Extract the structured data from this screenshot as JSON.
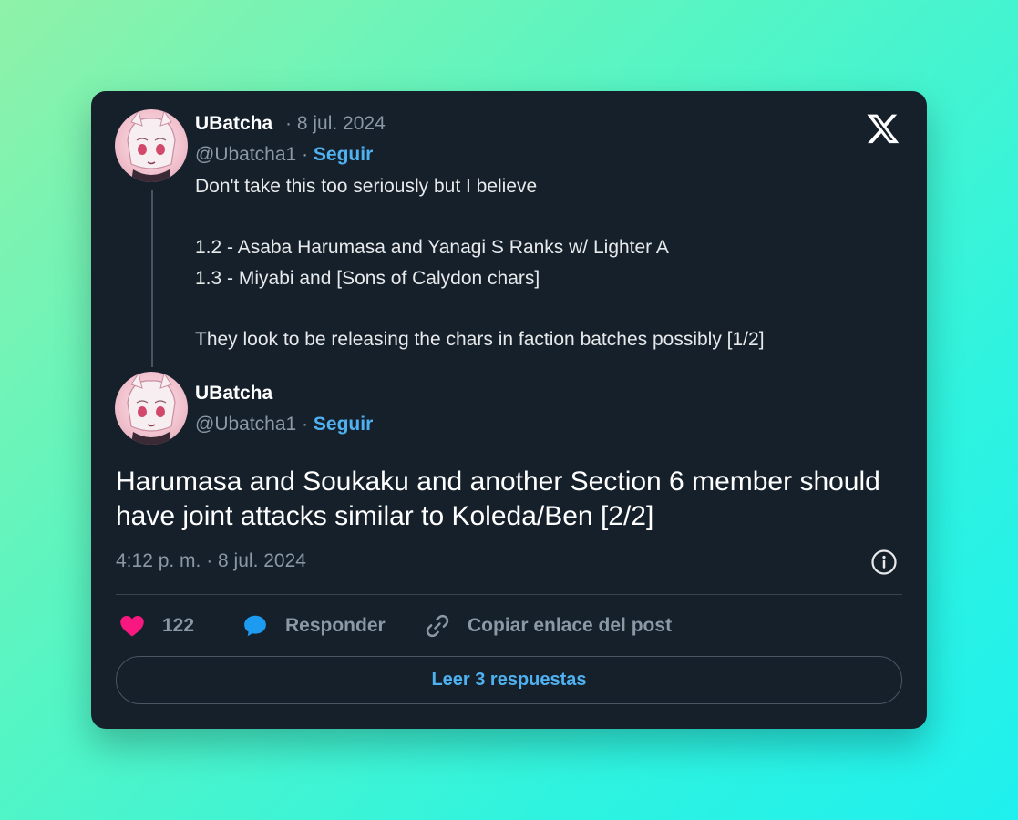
{
  "thread": [
    {
      "author_name": "UBatcha",
      "date": "8 jul. 2024",
      "handle": "@Ubatcha1",
      "follow_label": "Seguir",
      "lines": [
        "Don't take this too seriously but I believe",
        "",
        "1.2 - Asaba Harumasa and Yanagi S Ranks w/ Lighter A",
        "1.3 - Miyabi and [Sons of Calydon chars]",
        "",
        "They look to be releasing the chars in faction batches possibly [1/2]"
      ]
    },
    {
      "author_name": "UBatcha",
      "handle": "@Ubatcha1",
      "follow_label": "Seguir",
      "text": "Harumasa and Soukaku and another Section 6 member should have joint attacks similar to Koleda/Ben [2/2]",
      "timestamp": "4:12 p. m. · 8 jul. 2024"
    }
  ],
  "separator": "·",
  "actions": {
    "like_count": "122",
    "reply_label": "Responder",
    "copy_link_label": "Copiar enlace del post"
  },
  "read_replies_label": "Leer 3 respuestas",
  "icons": {
    "logo": "x-logo-icon",
    "like": "heart-icon",
    "reply": "speech-bubble-icon",
    "copy": "link-icon",
    "info": "info-icon"
  },
  "colors": {
    "card_bg": "#15202b",
    "accent": "#4fb1f0",
    "like": "#f91880",
    "reply_icon": "#1d9bf0",
    "muted": "#8b98a5"
  }
}
